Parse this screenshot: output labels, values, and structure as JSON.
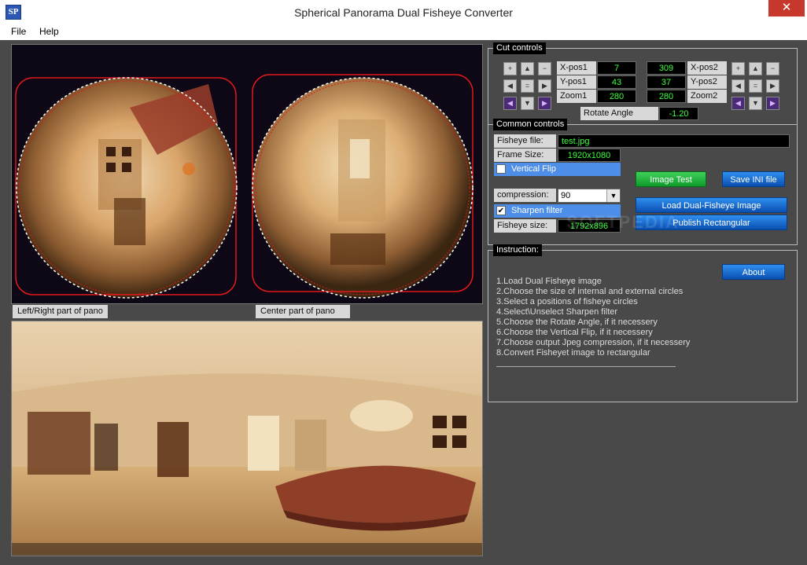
{
  "window": {
    "app_icon_text": "SP",
    "title": "Spherical Panorama Dual Fisheye Converter",
    "close_glyph": "✕"
  },
  "menu": {
    "file": "File",
    "help": "Help"
  },
  "views": {
    "left_right_label": "Left/Right part of pano",
    "center_label": "Center part of pano"
  },
  "cut_controls": {
    "title": "Cut controls",
    "xpos1_label": "X-pos1",
    "xpos1_value": "7",
    "ypos1_label": "Y-pos1",
    "ypos1_value": "43",
    "zoom1_label": "Zoom1",
    "zoom1_value": "280",
    "xpos2_label": "X-pos2",
    "xpos2_value": "309",
    "ypos2_label": "Y-pos2",
    "ypos2_value": "37",
    "zoom2_label": "Zoom2",
    "zoom2_value": "280",
    "rotate_label": "Rotate Angle",
    "rotate_value": "-1.20"
  },
  "common_controls": {
    "title": "Common controls",
    "fisheye_file_label": "Fisheye file:",
    "fisheye_file_value": "test.jpg",
    "frame_size_label": "Frame Size:",
    "frame_size_value": "1920x1080",
    "vertical_flip_label": "Vertical Flip",
    "vertical_flip_checked": false,
    "compression_label": "compression:",
    "compression_value": "90",
    "sharpen_label": "Sharpen filter",
    "sharpen_checked": true,
    "sharpen_check_glyph": "✔",
    "fisheye_size_label": "Fisheye size:",
    "fisheye_size_value": "1792x896",
    "image_test_button": "Image Test",
    "save_ini_button": "Save INI file",
    "load_button": "Load Dual-Fisheye Image",
    "publish_button": "Publish Rectangular"
  },
  "instruction": {
    "title": "Instruction:",
    "about_button": "About",
    "lines": [
      "1.Load Dual Fisheye image",
      "2.Choose the size of internal and external circles",
      "3.Select a positions of fisheye circles",
      "4.Select\\Unselect Sharpen filter",
      "5.Choose the Rotate Angle, if it necessery",
      "6.Choose the Vertical Flip, if it necessery",
      "7.Choose output Jpeg compression, if it necessery",
      "8.Convert Fisheyet image to rectangular"
    ]
  },
  "watermark": "SOFTPEDIA",
  "colors": {
    "value_text": "#3eff3e",
    "overlay_red": "#e01a1a",
    "check_row_blue": "#4d8ee8"
  }
}
